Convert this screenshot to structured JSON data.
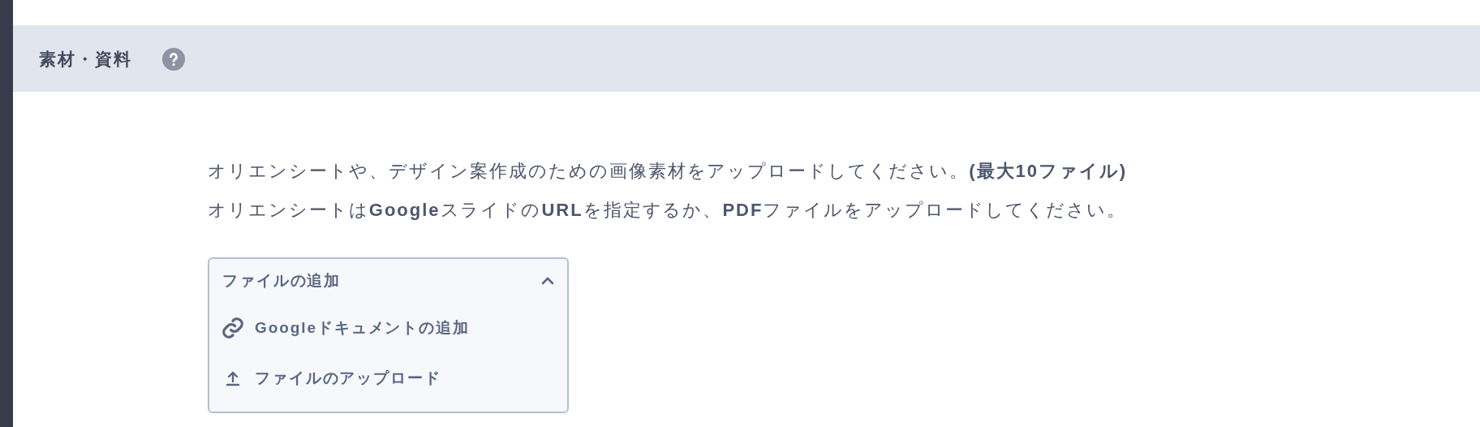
{
  "section": {
    "title": "素材・資料"
  },
  "description": [
    "オリエンシートや、デザイン案作成のための画像素材をアップロードしてください。**(最大10ファイル)**",
    "オリエンシートは**Google**スライドの**URL**を指定するか、**PDF**ファイルをアップロードしてください。"
  ],
  "file_menu": {
    "label": "ファイルの追加",
    "expanded": true,
    "items": [
      {
        "kind": "link",
        "label": "Googleドキュメントの追加"
      },
      {
        "kind": "upload",
        "label": "ファイルのアップロード"
      }
    ]
  }
}
